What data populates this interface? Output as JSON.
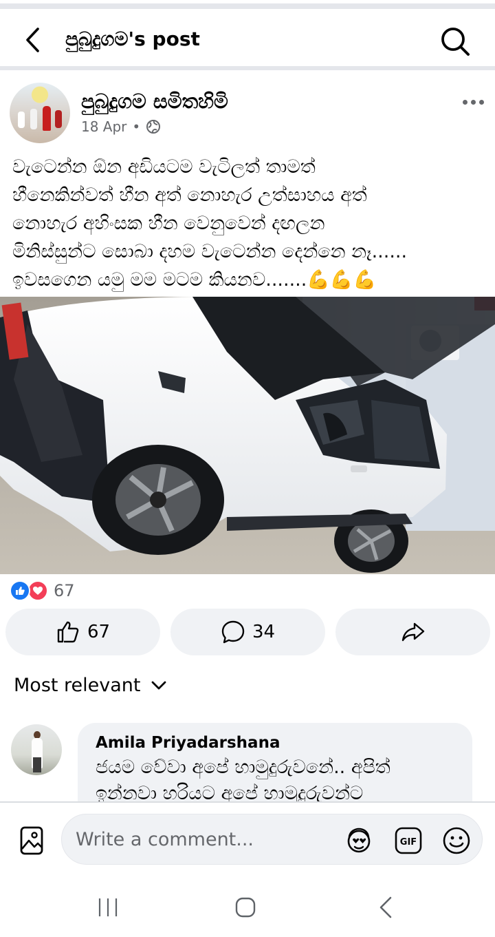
{
  "header": {
    "title": "පුබුදුගම's post"
  },
  "post": {
    "page_name": "පුබුදුගම සමිතහිමි",
    "date": "18 Apr",
    "privacy": "public-globe-icon",
    "text_lines": [
      "වැටෙන්න ඕන අඩියටම වැටිලත් තාමත්",
      "හීනෙකින්වත් හීන අත් නොහැර උත්සාහය අත්",
      "නොහැර අහිංසක  හීන වෙනුවෙන් දඟලන",
      "මිනිස්සුන්ට සොබා දහම වැටෙන්න දෙන්නෙ නෑ......",
      "ඉවසගෙන යමු මම මටම කියනව.......💪💪💪"
    ],
    "reaction_count": "67"
  },
  "actions": {
    "like_count": "67",
    "comment_count": "34"
  },
  "comments": {
    "sort_label": "Most relevant",
    "items": [
      {
        "author": "Amila Priyadarshana",
        "text": "ජයම වේවා අපේ හාමුදුරුවනේ.. අපිත් ඉන්නවා හරියට අපේ හාමුදුරුවන්ට"
      }
    ]
  },
  "composer": {
    "placeholder": "Write a comment..."
  },
  "colors": {
    "accent_blue": "#1877f2",
    "love_red": "#f33e58",
    "muted_text": "#65676b",
    "button_bg": "#f0f2f5"
  }
}
